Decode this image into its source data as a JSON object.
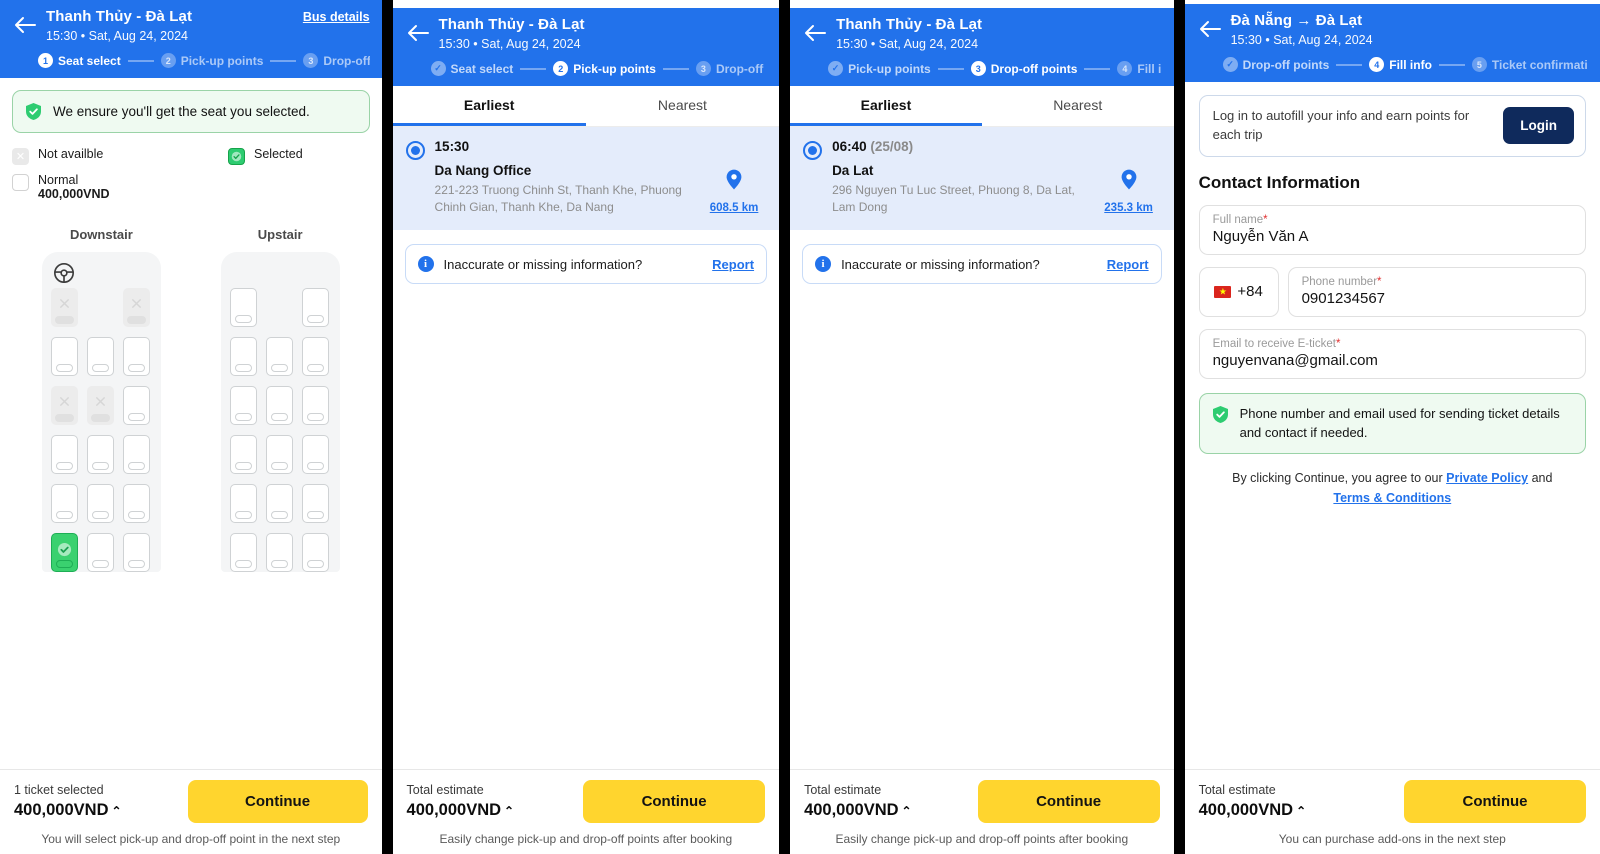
{
  "panels": {
    "seat_select": {
      "header": {
        "back_icon": "arrow-left-icon",
        "title": "Thanh Thủy - Đà Lạt",
        "subtitle": "15:30 • Sat, Aug 24, 2024",
        "bus_details_label": "Bus details",
        "steps": [
          {
            "num": "1",
            "label": "Seat select",
            "state": "active"
          },
          {
            "num": "2",
            "label": "Pick-up points",
            "state": "todo"
          },
          {
            "num": "3",
            "label": "Drop-off points",
            "state": "todo"
          }
        ]
      },
      "ensure_text": "We ensure you'll get the seat you selected.",
      "legend": {
        "not_available": "Not availble",
        "selected": "Selected",
        "normal": "Normal",
        "normal_price": "400,000VND"
      },
      "deck_labels": {
        "downstair": "Downstair",
        "upstair": "Upstair"
      },
      "decks": {
        "downstair": [
          [
            "na",
            "empty",
            "na"
          ],
          [
            "normal",
            "normal",
            "normal"
          ],
          [
            "na",
            "na",
            "normal"
          ],
          [
            "normal",
            "normal",
            "normal"
          ],
          [
            "normal",
            "normal",
            "normal"
          ],
          [
            "sel",
            "normal",
            "normal"
          ]
        ],
        "upstair": [
          [
            "normal",
            "empty",
            "normal"
          ],
          [
            "normal",
            "normal",
            "normal"
          ],
          [
            "normal",
            "normal",
            "normal"
          ],
          [
            "normal",
            "normal",
            "normal"
          ],
          [
            "normal",
            "normal",
            "normal"
          ],
          [
            "normal",
            "normal",
            "normal"
          ]
        ]
      },
      "bottom": {
        "caption": "1 ticket selected",
        "price": "400,000VND",
        "caret": "⌃",
        "continue_label": "Continue",
        "note": "You will select pick-up and drop-off point in the next step"
      }
    },
    "pickup_points": {
      "header": {
        "back_icon": "arrow-left-icon",
        "title": "Thanh Thủy - Đà Lạt",
        "subtitle": "15:30 • Sat, Aug 24, 2024",
        "steps": [
          {
            "num": "✓",
            "label": "Seat select",
            "state": "done"
          },
          {
            "num": "2",
            "label": "Pick-up points",
            "state": "active"
          },
          {
            "num": "3",
            "label": "Drop-off points",
            "state": "todo"
          }
        ]
      },
      "tabs": [
        {
          "label": "Earliest",
          "active": true
        },
        {
          "label": "Nearest",
          "active": false
        }
      ],
      "point": {
        "time": "15:30",
        "date_suffix": "",
        "name": "Da Nang Office",
        "address": "221-223 Truong Chinh St, Thanh Khe, Phuong Chinh Gian, Thanh Khe, Da Nang",
        "distance": "608.5 km"
      },
      "report": {
        "text": "Inaccurate or missing information?",
        "link": "Report"
      },
      "bottom": {
        "caption": "Total estimate",
        "price": "400,000VND",
        "caret": "⌃",
        "continue_label": "Continue",
        "note": "Easily change pick-up and drop-off points after booking"
      }
    },
    "dropoff_points": {
      "header": {
        "back_icon": "arrow-left-icon",
        "title": "Thanh Thủy - Đà Lạt",
        "subtitle": "15:30 • Sat, Aug 24, 2024",
        "steps": [
          {
            "num": "✓",
            "label": "Pick-up points",
            "state": "done"
          },
          {
            "num": "3",
            "label": "Drop-off points",
            "state": "active"
          },
          {
            "num": "4",
            "label": "Fill info",
            "state": "todo"
          }
        ]
      },
      "tabs": [
        {
          "label": "Earliest",
          "active": true
        },
        {
          "label": "Nearest",
          "active": false
        }
      ],
      "point": {
        "time": "06:40",
        "date_suffix": "(25/08)",
        "name": "Da Lat",
        "address": "296 Nguyen Tu Luc Street, Phuong 8, Da Lat, Lam Dong",
        "distance": "235.3 km"
      },
      "report": {
        "text": "Inaccurate or missing information?",
        "link": "Report"
      },
      "bottom": {
        "caption": "Total estimate",
        "price": "400,000VND",
        "caret": "⌃",
        "continue_label": "Continue",
        "note": "Easily change pick-up and drop-off points after booking"
      }
    },
    "fill_info": {
      "header": {
        "back_icon": "arrow-left-icon",
        "title": "Đà Nẵng → Đà Lạt",
        "subtitle": "15:30 • Sat, Aug 24, 2024",
        "steps": [
          {
            "num": "✓",
            "label": "Drop-off points",
            "state": "done"
          },
          {
            "num": "4",
            "label": "Fill info",
            "state": "active"
          },
          {
            "num": "5",
            "label": "Ticket confirmation",
            "state": "todo"
          }
        ]
      },
      "login_banner": {
        "text": "Log in to autofill your info and earn points for each trip",
        "button": "Login"
      },
      "section_title": "Contact Information",
      "fields": {
        "full_name": {
          "label": "Full name",
          "required": "*",
          "value": "Nguyễn Văn A"
        },
        "country_code": {
          "value": "+84",
          "flag": "vietnam-flag-icon"
        },
        "phone": {
          "label": "Phone number",
          "required": "*",
          "value": "0901234567"
        },
        "email": {
          "label": "Email to receive E-ticket",
          "required": "*",
          "value": "nguyenvana@gmail.com"
        }
      },
      "green_note": "Phone number and email used for sending ticket details and contact if needed.",
      "policy": {
        "prefix": "By clicking Continue, you agree to our ",
        "link1": "Private Policy",
        "middle": " and",
        "link2": "Terms & Conditions"
      },
      "bottom": {
        "caption": "Total estimate",
        "price": "400,000VND",
        "caret": "⌃",
        "continue_label": "Continue",
        "note": "You can purchase add-ons in the next step"
      }
    }
  },
  "colors": {
    "brand_blue": "#2272eb",
    "accent_yellow": "#ffd52e",
    "success_green": "#2ecc71",
    "login_navy": "#0f2a5c"
  }
}
